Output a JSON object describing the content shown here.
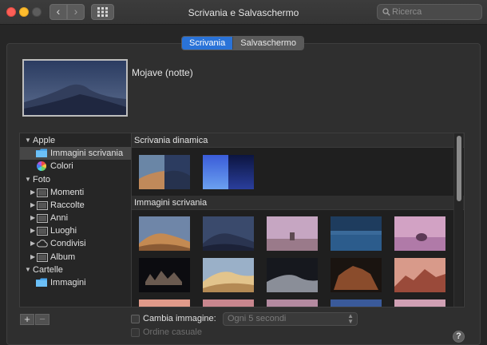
{
  "window": {
    "title": "Scrivania e Salvaschermo",
    "back_glyph": "‹",
    "forward_glyph": "›"
  },
  "search": {
    "placeholder": "Ricerca",
    "value": ""
  },
  "tabs": [
    {
      "label": "Scrivania",
      "active": true
    },
    {
      "label": "Salvaschermo",
      "active": false
    }
  ],
  "current_wallpaper": {
    "name": "Mojave (notte)"
  },
  "sidebar": {
    "apple": {
      "label": "Apple",
      "disclosure": "▼"
    },
    "desktop_images": {
      "label": "Immagini scrivania"
    },
    "colors": {
      "label": "Colori"
    },
    "photos": {
      "label": "Foto",
      "disclosure": "▼"
    },
    "moments": {
      "label": "Momenti",
      "disclosure": "▶"
    },
    "collections": {
      "label": "Raccolte",
      "disclosure": "▶"
    },
    "years": {
      "label": "Anni",
      "disclosure": "▶"
    },
    "places": {
      "label": "Luoghi",
      "disclosure": "▶"
    },
    "shared": {
      "label": "Condivisi",
      "disclosure": "▶"
    },
    "albums": {
      "label": "Album",
      "disclosure": "▶"
    },
    "folders": {
      "label": "Cartelle",
      "disclosure": "▼"
    },
    "pictures": {
      "label": "Immagini"
    }
  },
  "gallery": {
    "dynamic_header": "Scrivania dinamica",
    "images_header": "Immagini scrivania"
  },
  "bottom": {
    "add_label": "+",
    "remove_label": "−",
    "change_picture_label": "Cambia immagine:",
    "interval_value": "Ogni 5 secondi",
    "random_order_label": "Ordine casuale",
    "help_label": "?"
  },
  "colors": {
    "accent": "#2a73d8",
    "folder": "#4aa8f0",
    "window_bg": "#2f2f2f"
  }
}
